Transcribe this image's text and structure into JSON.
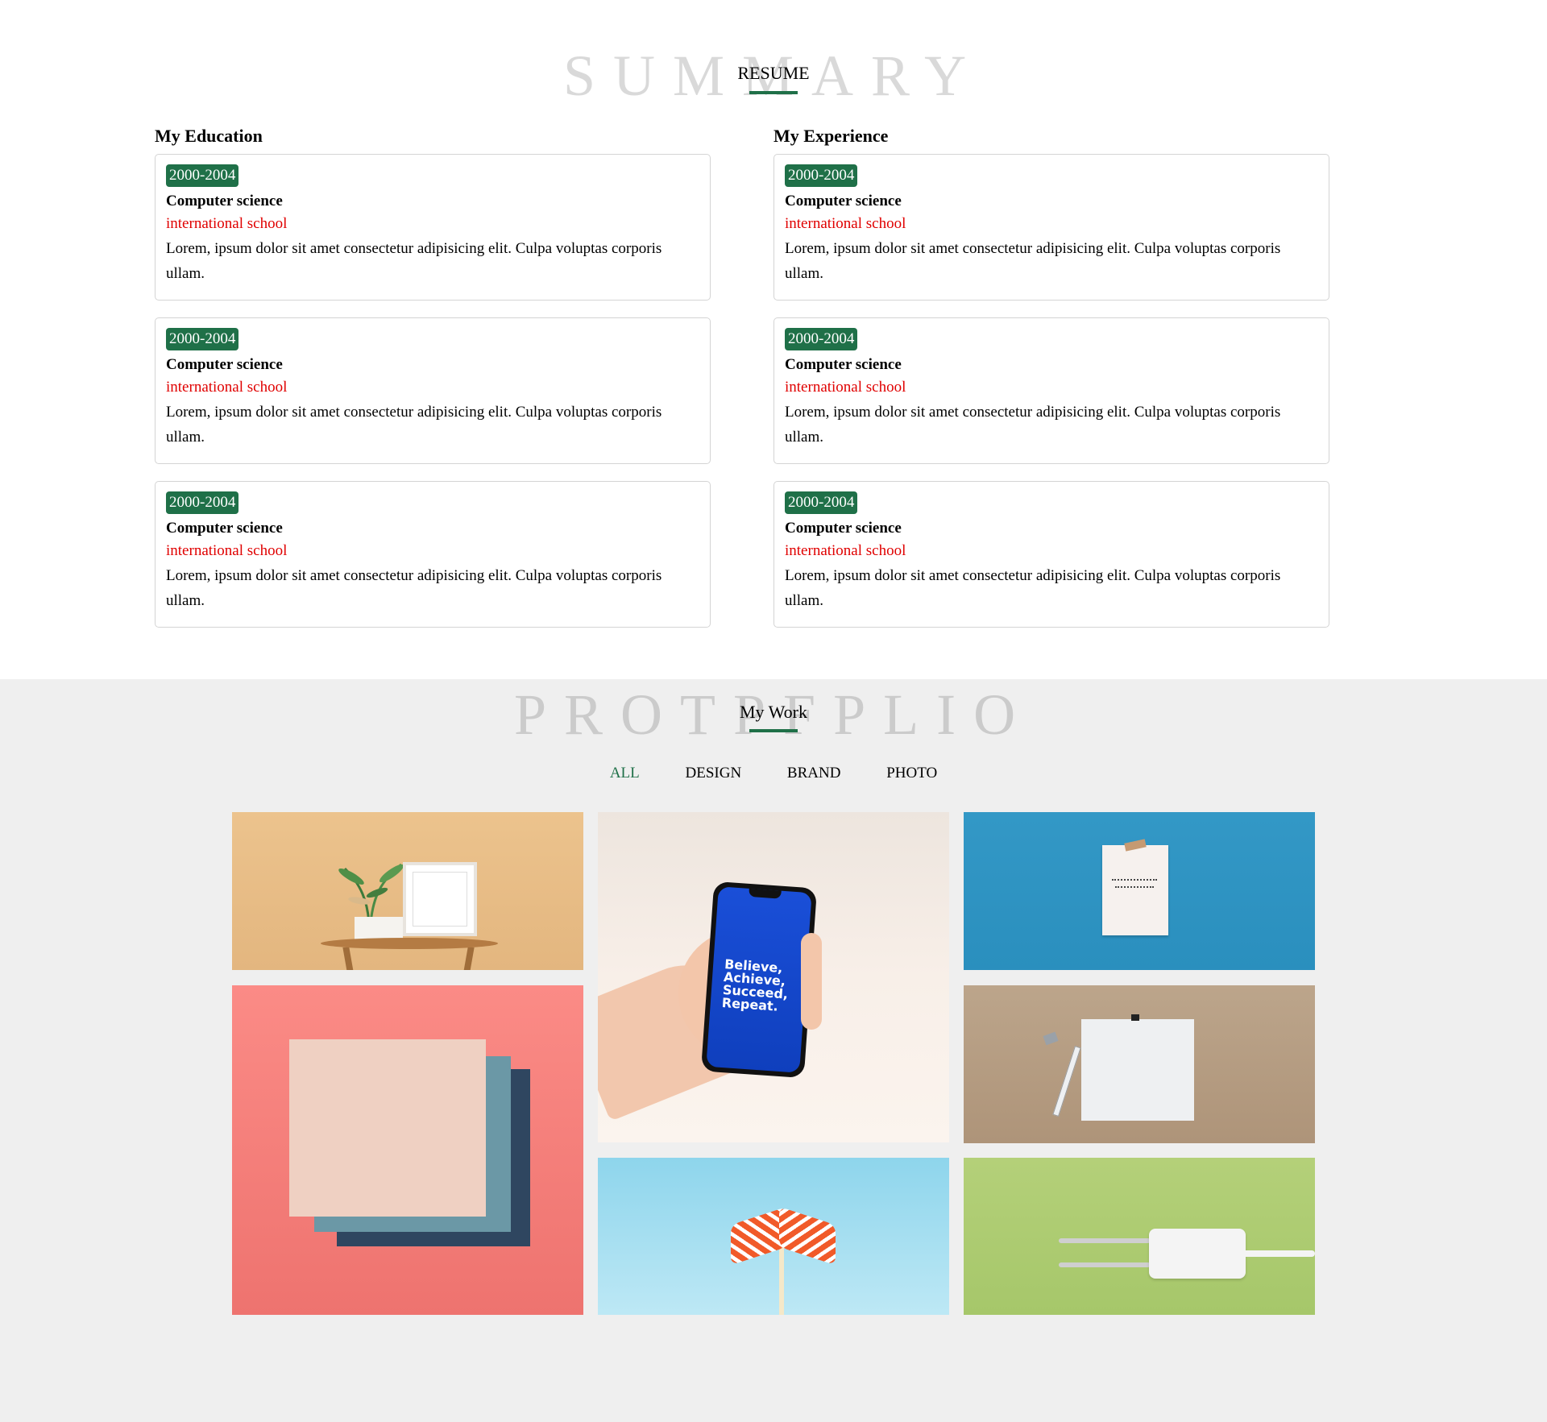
{
  "resume": {
    "ghost_title": "SUMMARY",
    "title": "RESUME",
    "education": {
      "heading": "My Education",
      "items": [
        {
          "years": "2000-2004",
          "degree": "Computer science",
          "school": "international school",
          "desc": "Lorem, ipsum dolor sit amet consectetur adipisicing elit. Culpa voluptas corporis ullam."
        },
        {
          "years": "2000-2004",
          "degree": "Computer science",
          "school": "international school",
          "desc": "Lorem, ipsum dolor sit amet consectetur adipisicing elit. Culpa voluptas corporis ullam."
        },
        {
          "years": "2000-2004",
          "degree": "Computer science",
          "school": "international school",
          "desc": "Lorem, ipsum dolor sit amet consectetur adipisicing elit. Culpa voluptas corporis ullam."
        }
      ]
    },
    "experience": {
      "heading": "My Experience",
      "items": [
        {
          "years": "2000-2004",
          "degree": "Computer science",
          "school": "international school",
          "desc": "Lorem, ipsum dolor sit amet consectetur adipisicing elit. Culpa voluptas corporis ullam."
        },
        {
          "years": "2000-2004",
          "degree": "Computer science",
          "school": "international school",
          "desc": "Lorem, ipsum dolor sit amet consectetur adipisicing elit. Culpa voluptas corporis ullam."
        },
        {
          "years": "2000-2004",
          "degree": "Computer science",
          "school": "international school",
          "desc": "Lorem, ipsum dolor sit amet consectetur adipisicing elit. Culpa voluptas corporis ullam."
        }
      ]
    }
  },
  "portfolio": {
    "ghost_title": "PROTPFPLIO",
    "title": "My Work",
    "filters": [
      "ALL",
      "DESIGN",
      "BRAND",
      "PHOTO"
    ],
    "active_filter": "ALL",
    "phone_screen_text": "Believe, Achieve, Succeed, Repeat."
  },
  "colors": {
    "accent": "#1f7048",
    "school_text": "#e00000",
    "portfolio_bg": "#efefef"
  }
}
